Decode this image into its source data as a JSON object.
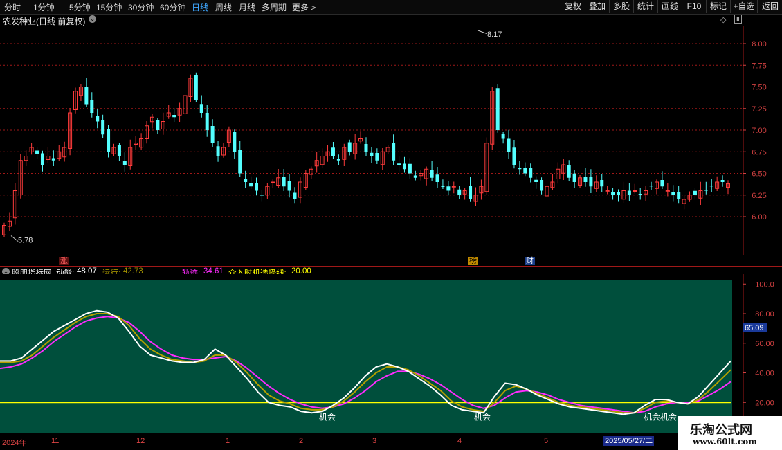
{
  "toolbar": {
    "periods": [
      "分时",
      "1分钟",
      "5分钟",
      "15分钟",
      "30分钟",
      "60分钟",
      "日线",
      "周线",
      "月线",
      "多周期",
      "更多 >"
    ],
    "active_period": "日线",
    "tools": [
      "复权",
      "叠加",
      "多股",
      "统计",
      "画线",
      "F10",
      "标记",
      "+自选",
      "返回"
    ]
  },
  "stock": {
    "title": "农发种业(日线 前复权)"
  },
  "price_axis": {
    "ticks": [
      "8.00",
      "7.75",
      "7.50",
      "7.25",
      "7.00",
      "6.75",
      "6.50",
      "6.25",
      "6.00"
    ]
  },
  "annotations": {
    "high": "8.17",
    "low": "5.78"
  },
  "badges": {
    "zhang": "涨",
    "bang": "榜",
    "cai": "财"
  },
  "indicator": {
    "name": "股朋指标网",
    "dongneng_label": "动能:",
    "dongneng_value": "48.07",
    "yunxing_label": "运行:",
    "yunxing_value": "42.73",
    "guiji_label": "轨迹:",
    "guiji_value": "34.61",
    "jieru_label": "介入时机选择线:",
    "jieru_value": "20.00",
    "axis_ticks": [
      "100.0",
      "80.00",
      "60.00",
      "40.00",
      "20.00"
    ],
    "current": "65.09",
    "signal_label": "机会",
    "signals": [
      "机会",
      "机会",
      "机会机会"
    ]
  },
  "dates": {
    "year": "2024年",
    "months": [
      "11",
      "12",
      "1",
      "2",
      "3",
      "4",
      "5"
    ],
    "cursor": "2025/05/27/二"
  },
  "watermark": {
    "line1": "乐淘公式网",
    "line2": "www.60lt.com"
  },
  "colors": {
    "up": "#ff3b3b",
    "down": "#54ffff",
    "grid": "#a01818",
    "panel": "#004f3c",
    "yellow": "#ffff00",
    "magenta": "#ff2bff",
    "olive": "#b4a000",
    "white": "#ffffff"
  },
  "chart_data": [
    {
      "type": "candlestick",
      "title": "农发种业(日线 前复权)",
      "ylim": [
        5.75,
        8.2
      ],
      "y_ticks": [
        6.0,
        6.25,
        6.5,
        6.75,
        7.0,
        7.25,
        7.5,
        7.75,
        8.0
      ],
      "max_label": 8.17,
      "min_label": 5.78,
      "close": [
        5.9,
        5.95,
        6.3,
        6.65,
        6.7,
        6.8,
        6.72,
        6.6,
        6.7,
        6.65,
        6.75,
        6.8,
        7.2,
        7.45,
        7.5,
        7.3,
        7.2,
        7.1,
        6.95,
        6.75,
        6.8,
        6.7,
        6.6,
        6.8,
        6.85,
        6.9,
        7.05,
        7.15,
        7.0,
        7.1,
        7.2,
        7.15,
        7.25,
        7.4,
        7.6,
        7.35,
        7.2,
        7.0,
        6.85,
        6.7,
        6.8,
        7.0,
        6.75,
        6.5,
        6.4,
        6.35,
        6.3,
        6.25,
        6.35,
        6.4,
        6.45,
        6.35,
        6.3,
        6.2,
        6.4,
        6.5,
        6.55,
        6.65,
        6.7,
        6.75,
        6.7,
        6.65,
        6.8,
        6.75,
        6.85,
        6.9,
        6.75,
        6.7,
        6.65,
        6.75,
        6.8,
        6.65,
        6.6,
        6.55,
        6.5,
        6.45,
        6.5,
        6.55,
        6.45,
        6.4,
        6.35,
        6.3,
        6.35,
        6.25,
        6.3,
        6.2,
        6.25,
        6.35,
        6.85,
        7.45,
        7.0,
        6.9,
        6.75,
        6.6,
        6.55,
        6.5,
        6.45,
        6.4,
        6.3,
        6.35,
        6.4,
        6.55,
        6.6,
        6.45,
        6.4,
        6.45,
        6.4,
        6.35,
        6.4,
        6.35,
        6.3,
        6.25,
        6.25,
        6.3,
        6.25,
        6.3,
        6.25,
        6.3,
        6.35,
        6.4,
        6.35,
        6.3,
        6.25,
        6.2,
        6.2,
        6.25,
        6.25,
        6.3,
        6.3,
        6.35,
        6.4,
        6.4,
        6.38
      ]
    },
    {
      "type": "line",
      "title": "股朋指标网",
      "ylim": [
        0,
        102
      ],
      "y_ticks": [
        20,
        40,
        60,
        80,
        100
      ],
      "series": [
        {
          "name": "动能",
          "values": [
            48,
            48,
            50,
            56,
            62,
            68,
            72,
            76,
            80,
            82,
            81,
            77,
            68,
            58,
            52,
            50,
            48,
            47,
            47,
            49,
            56,
            52,
            44,
            36,
            27,
            20,
            18,
            17,
            14,
            13,
            14,
            18,
            23,
            30,
            38,
            44,
            46,
            44,
            41,
            36,
            31,
            25,
            18,
            15,
            14,
            13,
            24,
            33,
            32,
            29,
            25,
            22,
            19,
            17,
            16,
            15,
            14,
            13,
            12,
            13,
            18,
            22,
            22,
            20,
            19,
            24,
            32,
            40,
            48
          ]
        },
        {
          "name": "运行",
          "values": [
            47,
            47,
            48,
            52,
            58,
            64,
            69,
            74,
            78,
            80,
            80,
            78,
            72,
            63,
            56,
            52,
            49,
            48,
            47,
            48,
            52,
            52,
            47,
            40,
            32,
            25,
            21,
            19,
            16,
            15,
            15,
            17,
            21,
            27,
            34,
            40,
            44,
            44,
            42,
            38,
            33,
            28,
            21,
            17,
            15,
            14,
            20,
            28,
            31,
            29,
            26,
            23,
            20,
            18,
            17,
            16,
            15,
            14,
            13,
            13,
            16,
            20,
            21,
            20,
            19,
            22,
            28,
            35,
            42
          ]
        },
        {
          "name": "轨迹",
          "values": [
            43,
            44,
            46,
            50,
            55,
            61,
            66,
            71,
            75,
            77,
            78,
            77,
            74,
            68,
            61,
            56,
            52,
            50,
            49,
            49,
            50,
            51,
            48,
            43,
            37,
            31,
            26,
            22,
            19,
            17,
            16,
            17,
            19,
            23,
            28,
            34,
            38,
            41,
            41,
            39,
            36,
            32,
            27,
            22,
            18,
            16,
            18,
            23,
            27,
            28,
            27,
            25,
            22,
            20,
            18,
            17,
            16,
            15,
            14,
            13,
            14,
            17,
            19,
            20,
            20,
            21,
            25,
            29,
            34
          ]
        },
        {
          "name": "介入时机选择线",
          "values": [
            20,
            20,
            20,
            20,
            20,
            20,
            20,
            20,
            20,
            20,
            20,
            20,
            20,
            20,
            20,
            20,
            20,
            20,
            20,
            20,
            20,
            20,
            20,
            20,
            20,
            20,
            20,
            20,
            20,
            20,
            20,
            20,
            20,
            20,
            20,
            20,
            20,
            20,
            20,
            20,
            20,
            20,
            20,
            20,
            20,
            20,
            20,
            20,
            20,
            20,
            20,
            20,
            20,
            20,
            20,
            20,
            20,
            20,
            20,
            20,
            20,
            20,
            20,
            20,
            20,
            20,
            20,
            20,
            20
          ]
        }
      ]
    }
  ]
}
